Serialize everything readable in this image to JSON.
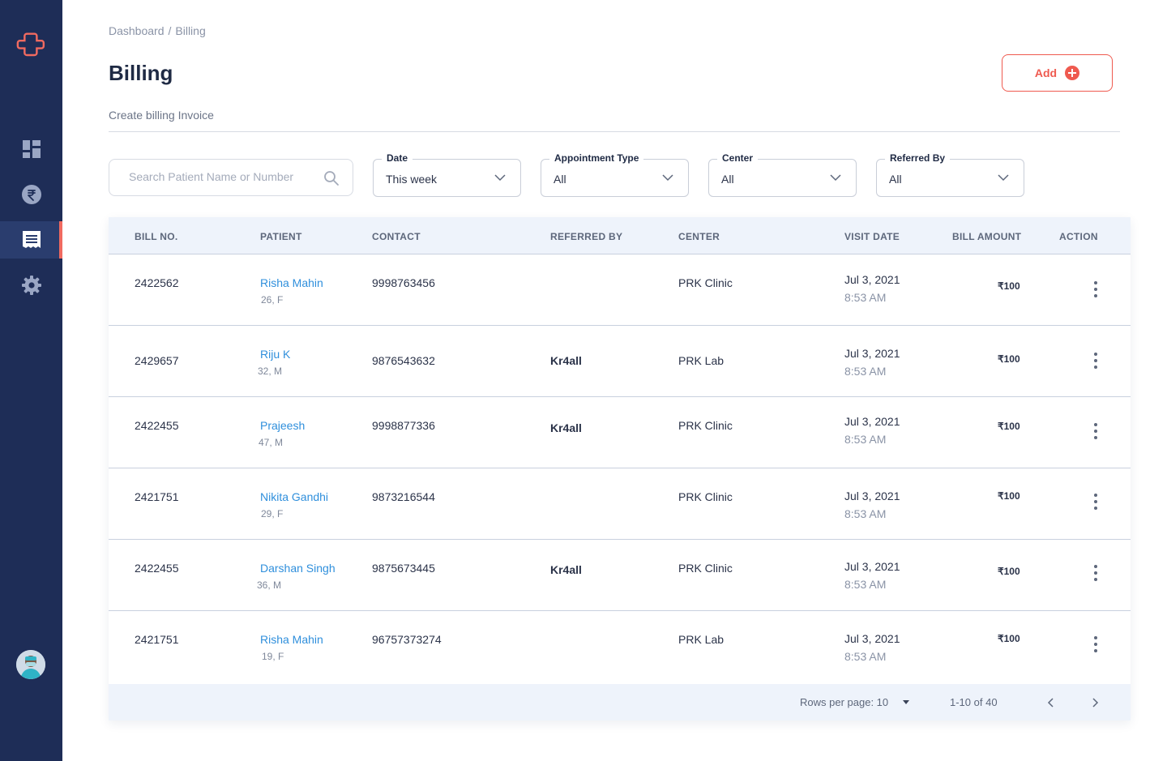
{
  "breadcrumb": {
    "root": "Dashboard",
    "separator": "/",
    "current": "Billing"
  },
  "page": {
    "title": "Billing",
    "subtitle": "Create billing Invoice"
  },
  "actions": {
    "add_label": "Add"
  },
  "search": {
    "placeholder": "Search Patient Name or Number",
    "value": ""
  },
  "filters": [
    {
      "label": "Date",
      "value": "This week"
    },
    {
      "label": "Appointment Type",
      "value": "All"
    },
    {
      "label": "Center",
      "value": "All"
    },
    {
      "label": "Referred By",
      "value": "All"
    }
  ],
  "table": {
    "columns": [
      "BILL NO.",
      "PATIENT",
      "CONTACT",
      "REFERRED BY",
      "CENTER",
      "VISIT DATE",
      "BILL AMOUNT",
      "ACTION"
    ],
    "rows": [
      {
        "bill_no": "2422562",
        "patient": "Risha Mahin",
        "meta": "26, F",
        "contact": "9998763456",
        "referred_by": "",
        "center": "PRK Clinic",
        "date": "Jul 3, 2021",
        "time": "8:53 AM",
        "amount": "₹100"
      },
      {
        "bill_no": "2429657",
        "patient": "Riju K",
        "meta": "32, M",
        "contact": "9876543632",
        "referred_by": "Kr4all",
        "center": "PRK Lab",
        "date": "Jul 3, 2021",
        "time": "8:53 AM",
        "amount": "₹100"
      },
      {
        "bill_no": "2422455",
        "patient": "Prajeesh",
        "meta": "47, M",
        "contact": "9998877336",
        "referred_by": "Kr4all",
        "center": "PRK Clinic",
        "date": "Jul 3, 2021",
        "time": "8:53 AM",
        "amount": "₹100"
      },
      {
        "bill_no": "2421751",
        "patient": "Nikita Gandhi",
        "meta": "29, F",
        "contact": "9873216544",
        "referred_by": "",
        "center": "PRK Clinic",
        "date": "Jul 3, 2021",
        "time": "8:53 AM",
        "amount": "₹100"
      },
      {
        "bill_no": "2422455",
        "patient": "Darshan Singh",
        "meta": "36, M",
        "contact": "9875673445",
        "referred_by": "Kr4all",
        "center": "PRK Clinic",
        "date": "Jul 3, 2021",
        "time": "8:53 AM",
        "amount": "₹100"
      },
      {
        "bill_no": "2421751",
        "patient": "Risha Mahin",
        "meta": "19, F",
        "contact": "96757373274",
        "referred_by": "",
        "center": "PRK Lab",
        "date": "Jul 3, 2021",
        "time": "8:53 AM",
        "amount": "₹100"
      }
    ]
  },
  "pagination": {
    "rows_per_page_label": "Rows per page: 10",
    "range": "1-10 of 40"
  },
  "sidebar": {
    "items": [
      {
        "icon": "dashboard-icon"
      },
      {
        "icon": "rupee-icon"
      },
      {
        "icon": "billing-icon",
        "active": true
      },
      {
        "icon": "gear-icon"
      }
    ]
  },
  "colors": {
    "sidebar_bg": "#1e2d57",
    "accent": "#ef5a4f",
    "link": "#2f8fdc",
    "table_header_bg": "#eef3fb"
  }
}
